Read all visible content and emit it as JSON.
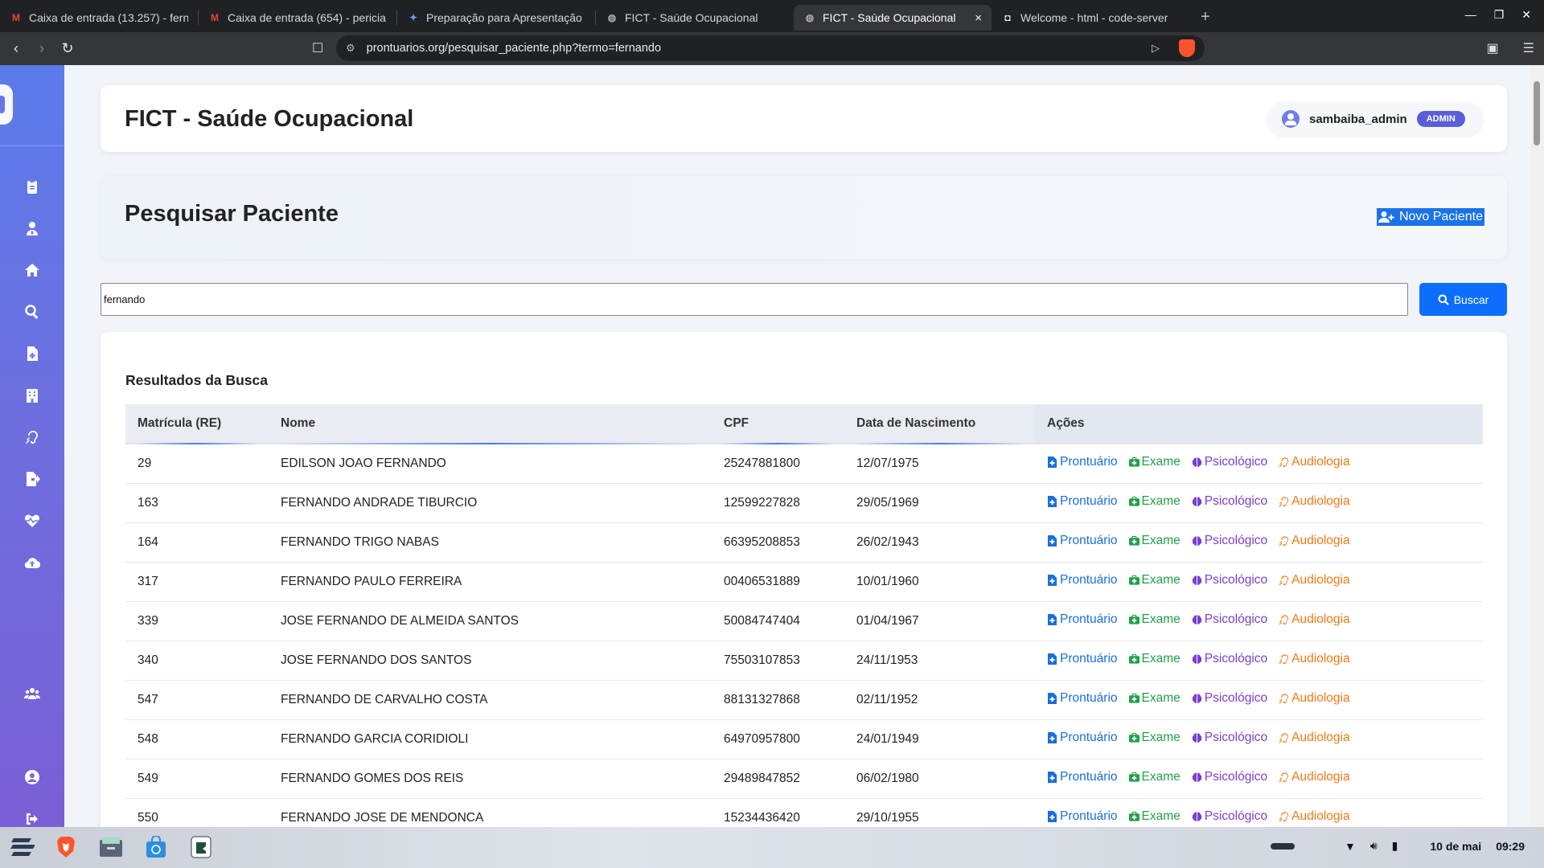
{
  "browser": {
    "tabs": [
      {
        "title": "Caixa de entrada (13.257) - fern",
        "favicon": "gmail-icon",
        "active": false
      },
      {
        "title": "Caixa de entrada (654) - pericia",
        "favicon": "gmail-icon",
        "active": false
      },
      {
        "title": "Preparação para Apresentação",
        "favicon": "gemini-icon",
        "active": false
      },
      {
        "title": "FICT - Saúde Ocupacional",
        "favicon": "globe-icon",
        "active": false
      },
      {
        "title": "FICT - Saúde Ocupacional",
        "favicon": "globe-icon",
        "active": true
      },
      {
        "title": "Welcome - html - code-server",
        "favicon": "code-server-icon",
        "active": false
      }
    ],
    "url": "prontuarios.org/pesquisar_paciente.php?termo=fernando",
    "new_tab": "+",
    "tab_close": "×"
  },
  "header": {
    "app_title": "FICT - Saúde Ocupacional",
    "username": "sambaiba_admin",
    "role": "ADMIN"
  },
  "page": {
    "title": "Pesquisar Paciente",
    "new_patient_label": "Novo Paciente"
  },
  "search": {
    "value": "fernando",
    "button_label": "Buscar"
  },
  "results": {
    "title": "Resultados da Busca",
    "columns": [
      "Matrícula (RE)",
      "Nome",
      "CPF",
      "Data de Nascimento",
      "Ações"
    ],
    "actions": [
      "Prontuário",
      "Exame",
      "Psicológico",
      "Audiologia"
    ],
    "rows": [
      {
        "re": "29",
        "nome": "EDILSON JOAO FERNANDO",
        "cpf": "25247881800",
        "nasc": "12/07/1975"
      },
      {
        "re": "163",
        "nome": "FERNANDO ANDRADE TIBURCIO",
        "cpf": "12599227828",
        "nasc": "29/05/1969"
      },
      {
        "re": "164",
        "nome": "FERNANDO TRIGO NABAS",
        "cpf": "66395208853",
        "nasc": "26/02/1943"
      },
      {
        "re": "317",
        "nome": "FERNANDO PAULO FERREIRA",
        "cpf": "00406531889",
        "nasc": "10/01/1960"
      },
      {
        "re": "339",
        "nome": "JOSE FERNANDO DE ALMEIDA SANTOS",
        "cpf": "50084747404",
        "nasc": "01/04/1967"
      },
      {
        "re": "340",
        "nome": "JOSE FERNANDO DOS SANTOS",
        "cpf": "75503107853",
        "nasc": "24/11/1953"
      },
      {
        "re": "547",
        "nome": "FERNANDO DE CARVALHO COSTA",
        "cpf": "88131327868",
        "nasc": "02/11/1952"
      },
      {
        "re": "548",
        "nome": "FERNANDO GARCIA CORIDIOLI",
        "cpf": "64970957800",
        "nasc": "24/01/1949"
      },
      {
        "re": "549",
        "nome": "FERNANDO GOMES DOS REIS",
        "cpf": "29489847852",
        "nasc": "06/02/1980"
      },
      {
        "re": "550",
        "nome": "FERNANDO JOSE DE MENDONCA",
        "cpf": "15234436420",
        "nasc": "29/10/1955"
      }
    ]
  },
  "sidebar": {
    "items": [
      "clipboard-icon",
      "patient-icon",
      "home-icon",
      "search-icon",
      "file-medical-icon",
      "hospital-icon",
      "ear-icon",
      "file-export-icon",
      "heartbeat-icon",
      "cloud-upload-icon",
      "users-icon",
      "user-circle-icon",
      "logout-icon"
    ]
  },
  "taskbar": {
    "apps": [
      "zorin-menu-icon",
      "brave-icon",
      "files-icon",
      "store-icon",
      "terminal-icon"
    ],
    "date": "10 de mai",
    "time": "09:29"
  },
  "colors": {
    "sidebar_top": "#5b7bea",
    "sidebar_bottom": "#7a5fd6",
    "primary": "#0d6efd",
    "admin_badge": "#5a5ed9",
    "prontuario": "#1a6fe0",
    "exame": "#22a04b",
    "psicologico": "#7b3fd0",
    "audiologia": "#f07a12"
  }
}
